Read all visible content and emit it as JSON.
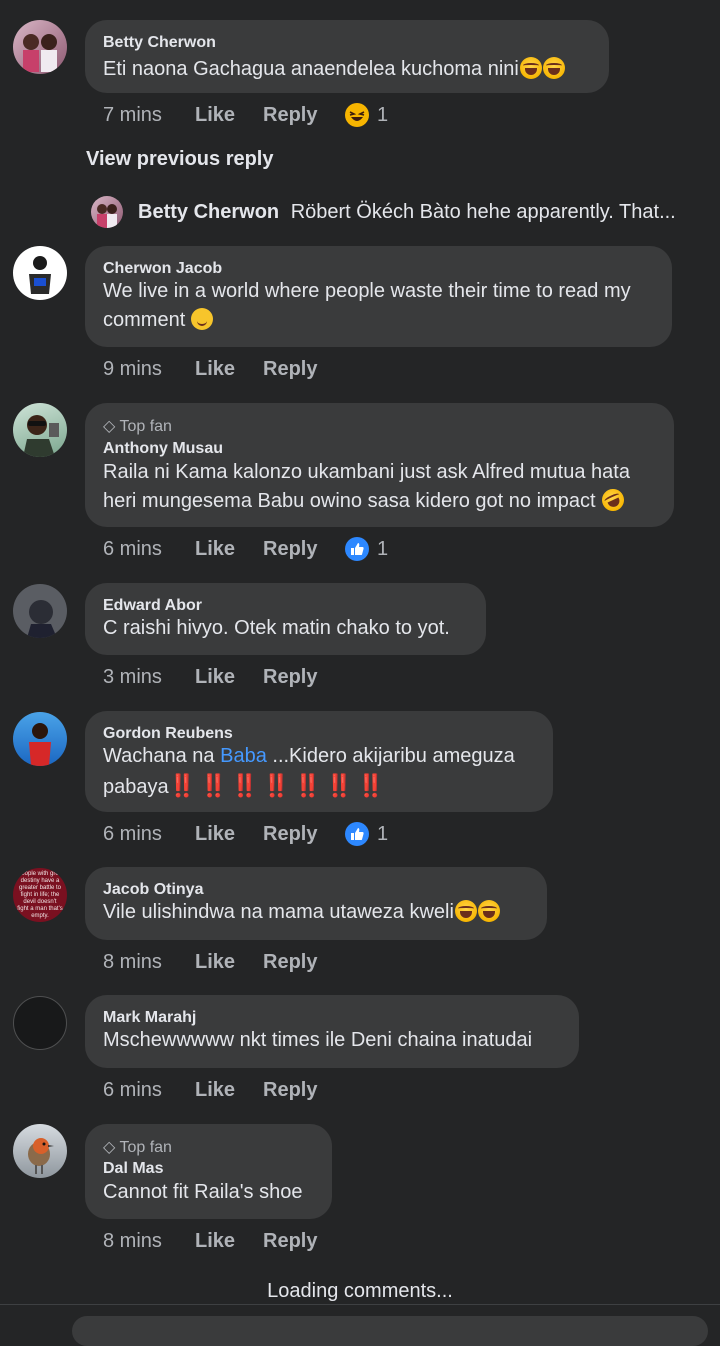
{
  "comments": [
    {
      "name": "Betty Cherwon",
      "text": "Eti naona Gachagua anaendelea kuchoma nini",
      "time": "7 mins",
      "like": "Like",
      "reply": "Reply",
      "reaction_count": "1"
    },
    {
      "name": "Cherwon Jacob",
      "text": "We live in a world where people waste their time to read my comment",
      "time": "9 mins",
      "like": "Like",
      "reply": "Reply"
    },
    {
      "badge": "Top fan",
      "name": "Anthony Musau",
      "text": "Raila ni Kama kalonzo ukambani just ask Alfred mutua hata heri mungesema Babu owino sasa kidero got no impact",
      "time": "6 mins",
      "like": "Like",
      "reply": "Reply",
      "reaction_count": "1"
    },
    {
      "name": "Edward Abor",
      "text": "C raishi hivyo. Otek matin chako to yot.",
      "time": "3 mins",
      "like": "Like",
      "reply": "Reply"
    },
    {
      "name": "Gordon Reubens",
      "text_a": "Wachana na ",
      "mention": "Baba",
      "text_b": "  ...Kidero akijaribu ameguza pabaya",
      "excl": "‼️‼️‼️‼️‼️‼️‼️",
      "time": "6 mins",
      "like": "Like",
      "reply": "Reply",
      "reaction_count": "1"
    },
    {
      "name": "Jacob Otinya",
      "text": "Vile ulishindwa na mama utaweza kweli",
      "time": "8 mins",
      "like": "Like",
      "reply": "Reply"
    },
    {
      "name": "Mark Marahj",
      "text": "Mschewwwww nkt times ile Deni chaina inatudai",
      "time": "6 mins",
      "like": "Like",
      "reply": "Reply"
    },
    {
      "badge": "Top fan",
      "name": "Dal Mas",
      "text": "Cannot fit Raila's shoe",
      "time": "8 mins",
      "like": "Like",
      "reply": "Reply"
    }
  ],
  "view_previous": "View previous reply",
  "reply_preview": {
    "name": "Betty Cherwon",
    "text": "Röbert Ökéch Bàto hehe apparently. That..."
  },
  "loading": "Loading comments...",
  "avatar_text": "eople with gre destiny have a greater battle to fight in life; the devil doesn't fight a man that's empty.",
  "colors": {
    "background": "#242526",
    "bubble": "#3a3b3c",
    "text": "#e4e6eb",
    "secondary": "#b0b3b8",
    "link": "#4599ff",
    "like_blue": "#2d88ff"
  }
}
